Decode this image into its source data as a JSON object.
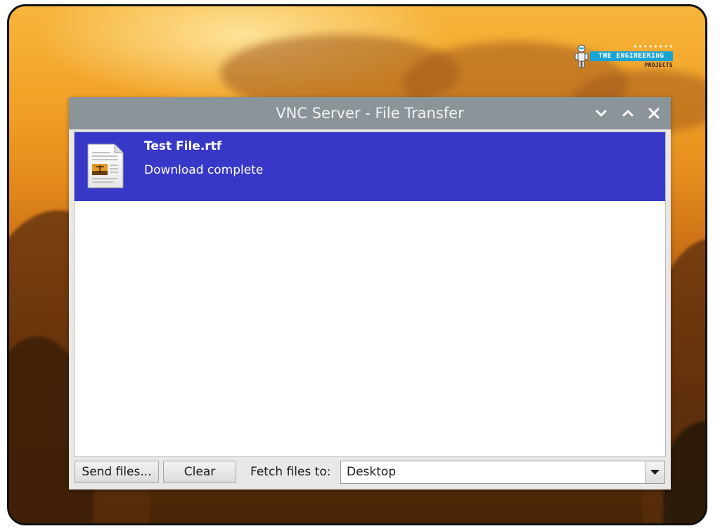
{
  "logo": {
    "tagline": "♦ ♦ ♦ ♦ ♦ ♦ ♦ ♦",
    "brand": "THE ENGINEERING",
    "sub": "PROJECTS"
  },
  "window": {
    "title": "VNC Server - File Transfer",
    "controls": [
      "minimize",
      "maximize",
      "close"
    ]
  },
  "transfers": [
    {
      "name": "Test File.rtf",
      "status": "Download complete",
      "icon": "document-image-icon"
    }
  ],
  "bottombar": {
    "send_label": "Send files...",
    "clear_label": "Clear",
    "fetch_label": "Fetch files to:",
    "fetch_destination": "Desktop"
  },
  "colors": {
    "titlebar": "#8b9599",
    "selection": "#3838c8",
    "wallpaper_top": "#f7b53c",
    "wallpaper_bottom": "#472406",
    "logo_accent": "#1aa3d6"
  }
}
